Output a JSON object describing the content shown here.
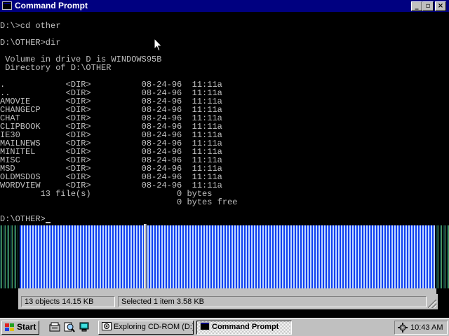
{
  "window": {
    "title": "Command Prompt",
    "controls": {
      "minimize": "_",
      "maximize": "▫",
      "close": "×"
    }
  },
  "console": {
    "lines": [
      "D:\\>cd other",
      "",
      "D:\\OTHER>dir",
      "",
      " Volume in drive D is WINDOWS95B",
      " Directory of D:\\OTHER",
      "",
      ".            <DIR>          08-24-96  11:11a",
      "..           <DIR>          08-24-96  11:11a",
      "AMOVIE       <DIR>          08-24-96  11:11a",
      "CHANGECP     <DIR>          08-24-96  11:11a",
      "CHAT         <DIR>          08-24-96  11:11a",
      "CLIPBOOK     <DIR>          08-24-96  11:11a",
      "IE30         <DIR>          08-24-96  11:11a",
      "MAILNEWS     <DIR>          08-24-96  11:11a",
      "MINITEL      <DIR>          08-24-96  11:11a",
      "MISC         <DIR>          08-24-96  11:11a",
      "MSD          <DIR>          08-24-96  11:11a",
      "OLDMSDOS     <DIR>          08-24-96  11:11a",
      "WORDVIEW     <DIR>          08-24-96  11:11a",
      "        13 file(s)                 0 bytes",
      "                                   0 bytes free",
      "",
      "D:\\OTHER>"
    ]
  },
  "explorer_status": {
    "objects": "13 objects  14.15 KB",
    "selected": "Selected 1 item  3.58 KB"
  },
  "taskbar": {
    "start_label": "Start",
    "tasks": [
      {
        "label": "Exploring CD-ROM (D:)",
        "active": false
      },
      {
        "label": "Command Prompt",
        "active": true
      }
    ],
    "clock": "10:43 AM"
  },
  "colors": {
    "titlebar": "#000080",
    "console_text": "#c0c0c0",
    "chrome": "#c0c0c0"
  }
}
